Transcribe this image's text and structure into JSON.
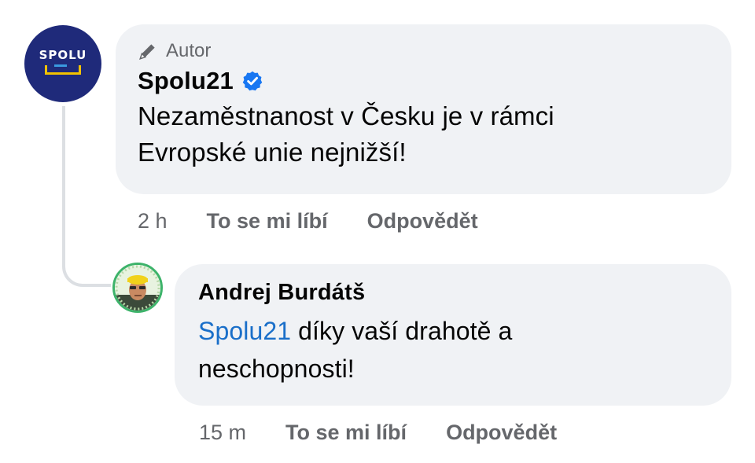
{
  "comments": [
    {
      "role_badge": "Autor",
      "author": "Spolu21",
      "avatar_text": "SPOLU",
      "verified": true,
      "text_line1": "Nezaměstnanost v Česku je v rámci",
      "text_line2": "Evropské unie nejnižší!",
      "time": "2 h",
      "like_label": "To se mi líbí",
      "reply_label": "Odpovědět"
    },
    {
      "author": "Andrej Burdátš",
      "mention": "Spolu21",
      "text_after_mention": " díky vaší drahotě a",
      "text_line2": "neschopnosti!",
      "time": "15 m",
      "like_label": "To se mi líbí",
      "reply_label": "Odpovědět"
    }
  ],
  "icons": {
    "author_badge": "pencil-icon",
    "verified": "verified-badge-icon"
  },
  "colors": {
    "bubble_bg": "#f0f2f5",
    "meta_gray": "#65676b",
    "mention_blue": "#1a6fc9",
    "verified_blue": "#1877f2",
    "spolu_navy": "#1f2a7a",
    "spolu_yellow": "#f2c200"
  }
}
